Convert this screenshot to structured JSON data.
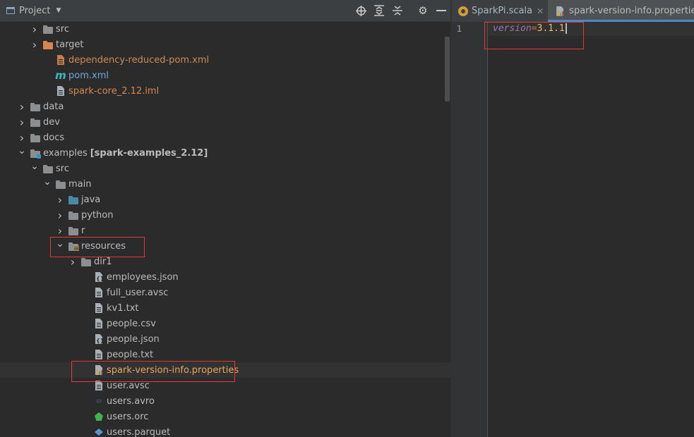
{
  "project_panel": {
    "title": "Project",
    "actions": [
      "locate-icon",
      "expand-all-icon",
      "collapse-all-icon",
      "gear-icon",
      "hide-icon"
    ]
  },
  "tree": [
    {
      "label": "src",
      "icon": "folder",
      "expanded": false
    },
    {
      "label": "target",
      "icon": "folder-orange",
      "expanded": false
    },
    {
      "label": "dependency-reduced-pom.xml",
      "icon": "xml-file"
    },
    {
      "label": "pom.xml",
      "icon": "maven-file"
    },
    {
      "label": "spark-core_2.12.iml",
      "icon": "iml-file"
    },
    {
      "label": "data",
      "icon": "folder",
      "expanded": false
    },
    {
      "label": "dev",
      "icon": "folder",
      "expanded": false
    },
    {
      "label": "docs",
      "icon": "folder",
      "expanded": false
    },
    {
      "label": "examples",
      "suffix": "[spark-examples_2.12]",
      "icon": "module-folder",
      "expanded": true
    },
    {
      "label": "src",
      "icon": "folder",
      "expanded": true
    },
    {
      "label": "main",
      "icon": "folder",
      "expanded": true
    },
    {
      "label": "java",
      "icon": "folder-blue",
      "expanded": false
    },
    {
      "label": "python",
      "icon": "folder",
      "expanded": false
    },
    {
      "label": "r",
      "icon": "folder",
      "expanded": false
    },
    {
      "label": "resources",
      "icon": "resources-folder",
      "expanded": true
    },
    {
      "label": "dir1",
      "icon": "folder",
      "expanded": false
    },
    {
      "label": "employees.json",
      "icon": "json-file"
    },
    {
      "label": "full_user.avsc",
      "icon": "text-file"
    },
    {
      "label": "kv1.txt",
      "icon": "text-file"
    },
    {
      "label": "people.csv",
      "icon": "text-file"
    },
    {
      "label": "people.json",
      "icon": "json-file"
    },
    {
      "label": "people.txt",
      "icon": "text-file"
    },
    {
      "label": "spark-version-info.properties",
      "icon": "properties-file",
      "selected": true
    },
    {
      "label": "user.avsc",
      "icon": "text-file"
    },
    {
      "label": "users.avro",
      "icon": "avro-file"
    },
    {
      "label": "users.orc",
      "icon": "orc-file"
    },
    {
      "label": "users.parquet",
      "icon": "parquet-file"
    }
  ],
  "editor": {
    "tabs": [
      {
        "label": "SparkPi.scala",
        "icon": "scala-file-icon",
        "active": false
      },
      {
        "label": "spark-version-info.properties",
        "icon": "properties-file-icon",
        "active": true
      }
    ],
    "line_number": "1",
    "code": {
      "key": "version",
      "eq": "=",
      "value": "3.1.1"
    }
  },
  "colors": {
    "highlight": "#e53935",
    "orange_text": "#d48a51",
    "maven_blue": "#3eb8c9"
  }
}
